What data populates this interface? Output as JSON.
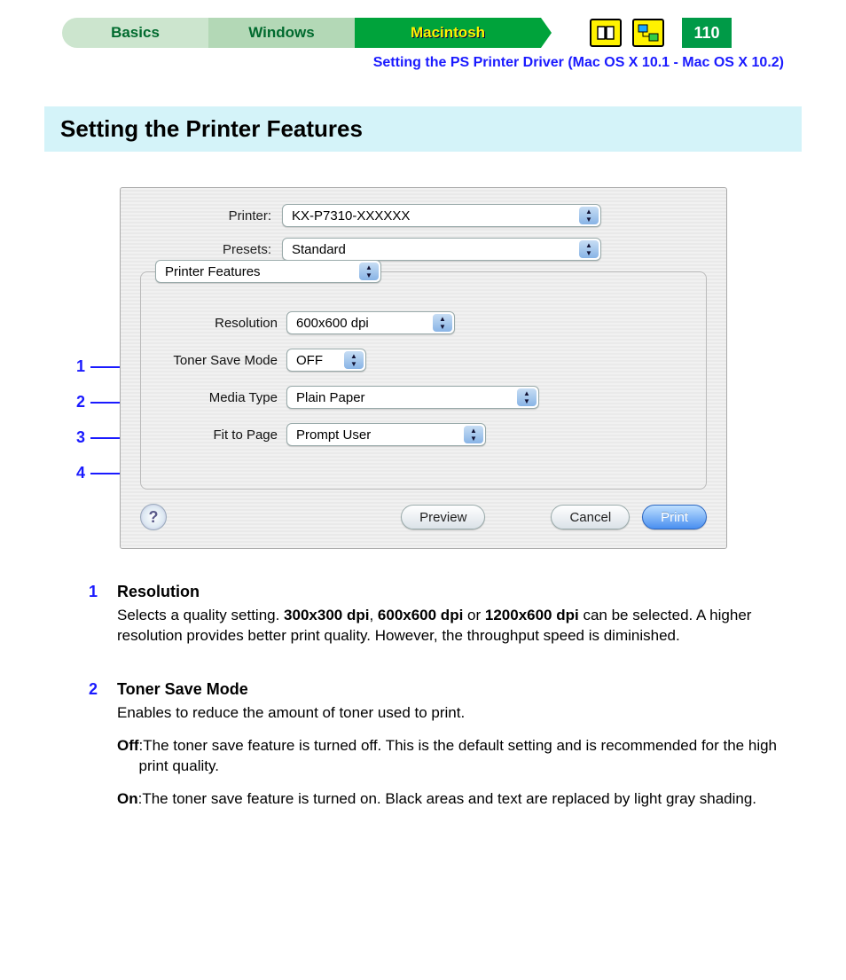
{
  "nav": {
    "tabs": {
      "basics": "Basics",
      "windows": "Windows",
      "macintosh": "Macintosh"
    },
    "page_number": "110"
  },
  "breadcrumb": "Setting the PS Printer Driver (Mac OS X 10.1 - Mac OS X 10.2)",
  "section_title": "Setting the Printer Features",
  "dialog": {
    "printer_label": "Printer:",
    "printer_value": "KX-P7310-XXXXXX",
    "presets_label": "Presets:",
    "presets_value": "Standard",
    "features_tab": "Printer Features",
    "rows": {
      "resolution": {
        "label": "Resolution",
        "value": "600x600 dpi"
      },
      "toner": {
        "label": "Toner Save Mode",
        "value": "OFF"
      },
      "media": {
        "label": "Media Type",
        "value": "Plain Paper"
      },
      "fit": {
        "label": "Fit to Page",
        "value": "Prompt User"
      }
    },
    "buttons": {
      "help": "?",
      "preview": "Preview",
      "cancel": "Cancel",
      "print": "Print"
    }
  },
  "callout_numbers": {
    "n1": "1",
    "n2": "2",
    "n3": "3",
    "n4": "4"
  },
  "descriptions": {
    "d1": {
      "num": "1",
      "title": "Resolution",
      "text_pre": "Selects a quality setting. ",
      "b1": "300x300 dpi",
      "sep1": ", ",
      "b2": "600x600 dpi",
      "sep2": " or ",
      "b3": "1200x600 dpi",
      "text_post": " can be selected. A higher resolution provides better print quality. However, the throughput speed is diminished."
    },
    "d2": {
      "num": "2",
      "title": "Toner Save Mode",
      "intro": "Enables to reduce the amount of toner used to print.",
      "off_k": "Off",
      "off_v": ":The toner save feature is turned off. This is the default setting and is recommended for the high print quality.",
      "on_k": "On",
      "on_v": ":The toner save feature is turned on. Black areas and text are replaced by light gray shading."
    }
  }
}
